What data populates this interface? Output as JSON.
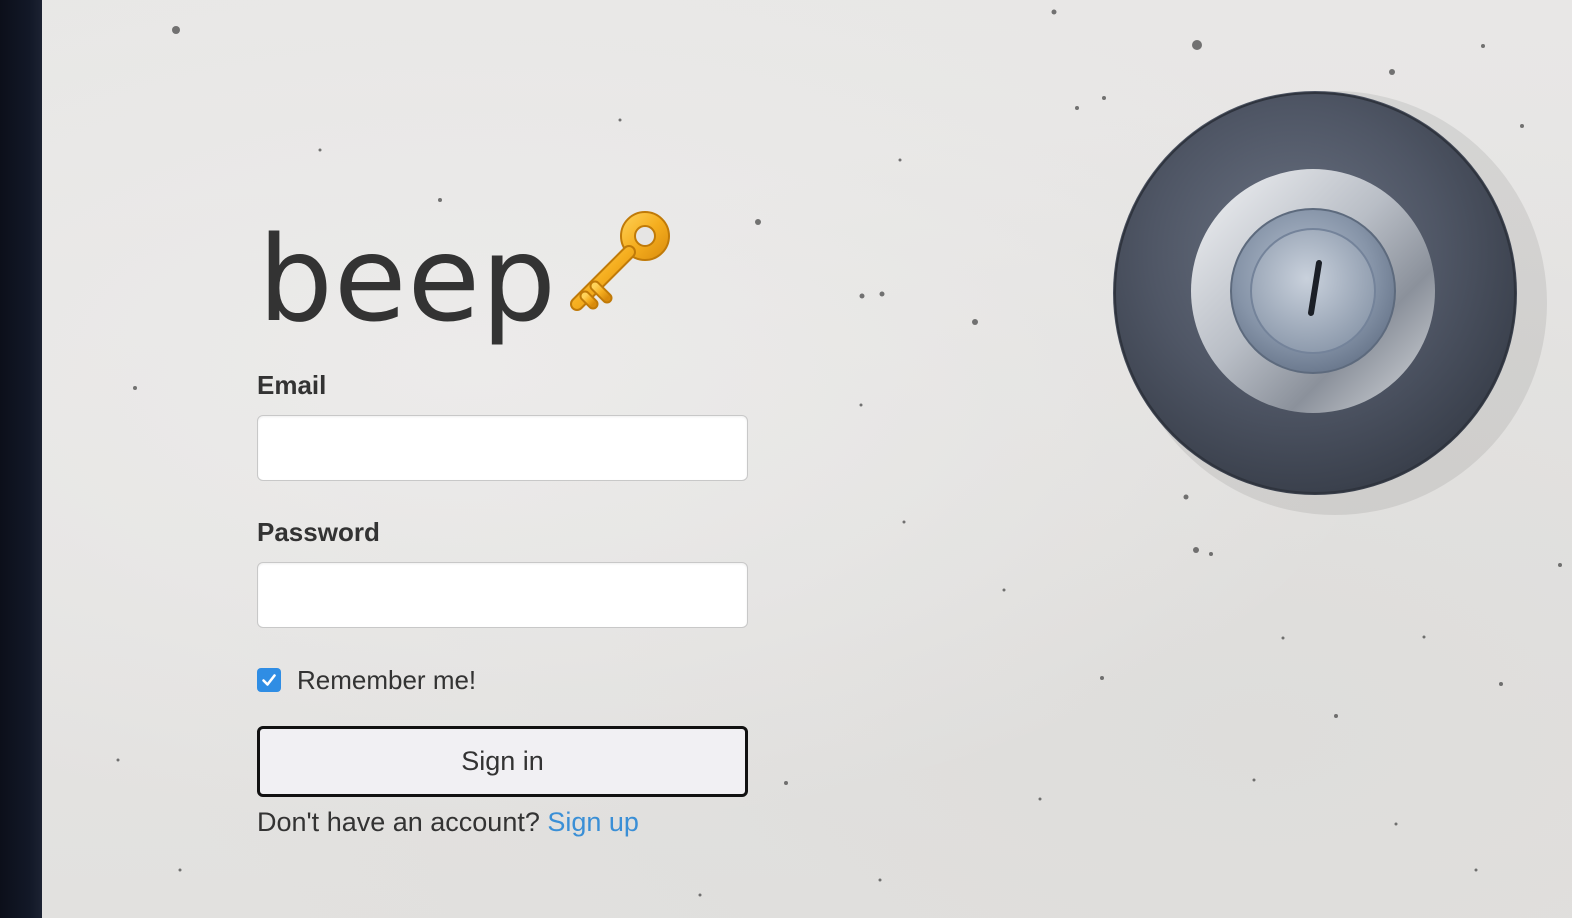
{
  "brand": {
    "name": "beep",
    "logo_icon": "key-icon"
  },
  "form": {
    "email_label": "Email",
    "email_value": "",
    "password_label": "Password",
    "password_value": "",
    "remember_label": "Remember me!",
    "remember_checked": true,
    "submit_label": "Sign in",
    "signup_prompt": "Don't have an account?",
    "signup_link": "Sign up"
  },
  "decor": {
    "lock_icon": "keyhole-lock-icon",
    "accent_color": "#3a8fd6",
    "checkbox_color": "#2f8de4",
    "key_color": "#f0a81c"
  }
}
